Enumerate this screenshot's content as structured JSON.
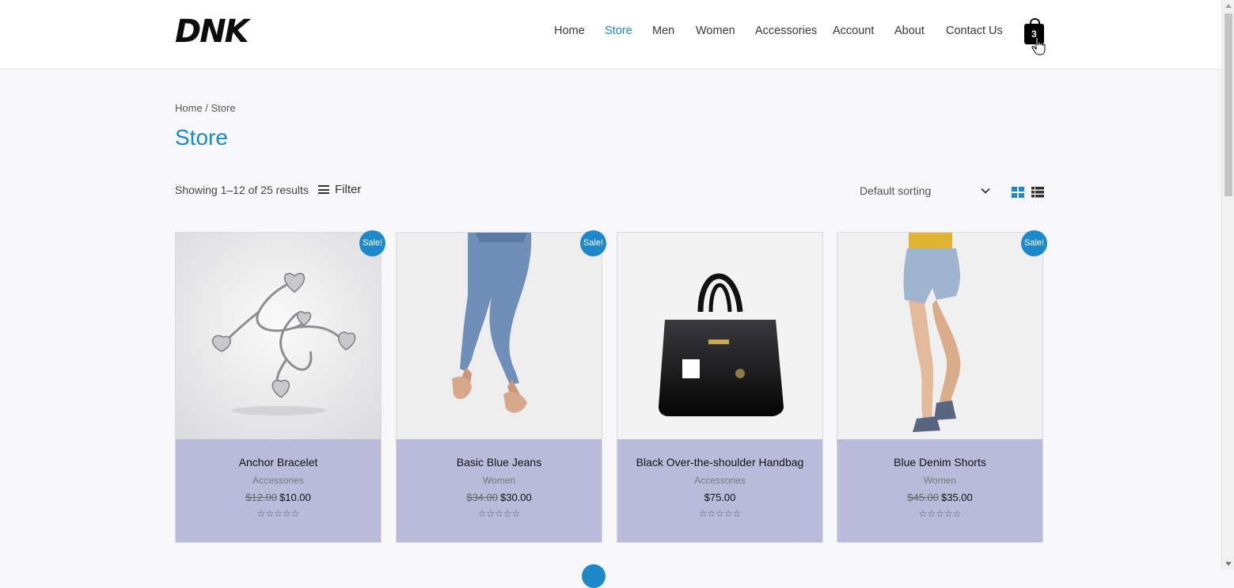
{
  "brand": {
    "logo_text": "DNK"
  },
  "nav": {
    "items": [
      {
        "label": "Home",
        "active": false
      },
      {
        "label": "Store",
        "active": true
      },
      {
        "label": "Men",
        "active": false
      },
      {
        "label": "Women",
        "active": false
      },
      {
        "label": "Accessories",
        "active": false
      },
      {
        "label": "Account",
        "active": false
      },
      {
        "label": "About",
        "active": false
      },
      {
        "label": "Contact Us",
        "active": false
      }
    ],
    "cart_count": "3"
  },
  "breadcrumb": "Home / Store",
  "page_title": "Store",
  "toolbar": {
    "result_count": "Showing 1–12 of 25 results",
    "filter_label": "Filter",
    "sorting_label": "Default sorting"
  },
  "products": [
    {
      "title": "Anchor Bracelet",
      "category": "Accessories",
      "old_price": "$12.00",
      "price": "$10.00",
      "sale": "Sale!",
      "rating": "☆☆☆☆☆"
    },
    {
      "title": "Basic Blue Jeans",
      "category": "Women",
      "old_price": "$34.00",
      "price": "$30.00",
      "sale": "Sale!",
      "rating": "☆☆☆☆☆"
    },
    {
      "title": "Black Over-the-shoulder Handbag",
      "category": "Accessories",
      "old_price": "",
      "price": "$75.00",
      "sale": "",
      "rating": "☆☆☆☆☆"
    },
    {
      "title": "Blue Denim Shorts",
      "category": "Women",
      "old_price": "$45.00",
      "price": "$35.00",
      "sale": "Sale!",
      "rating": "☆☆☆☆☆"
    }
  ],
  "colors": {
    "accent": "#1e88c9",
    "card_bg": "#babbdb"
  }
}
